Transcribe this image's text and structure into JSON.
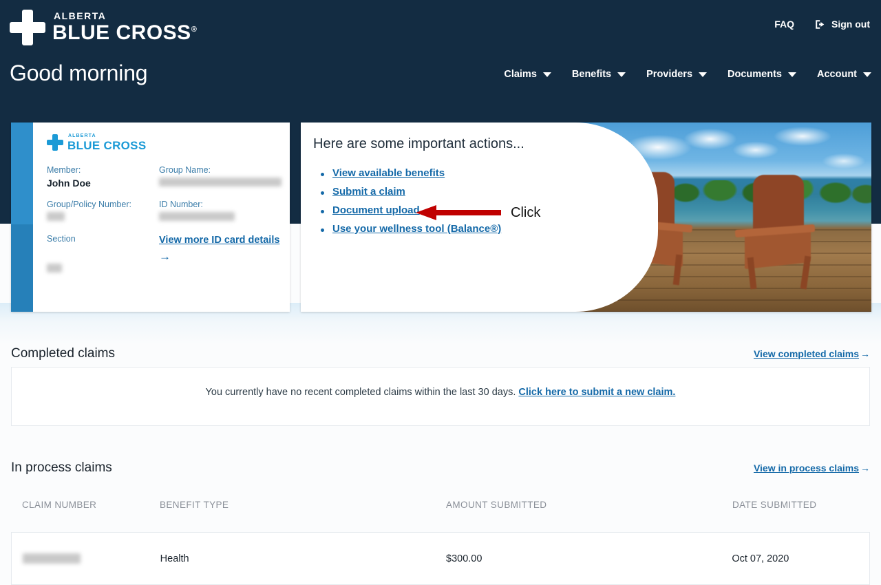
{
  "header": {
    "logo": {
      "alberta": "ALBERTA",
      "main": "BLUE CROSS",
      "reg": "®",
      "icon": "cross-icon"
    },
    "faq_label": "FAQ",
    "signout_label": "Sign out",
    "signout_icon": "sign-out-icon",
    "greeting": "Good morning",
    "nav": [
      {
        "label": "Claims",
        "icon": "chevron-down-icon"
      },
      {
        "label": "Benefits",
        "icon": "chevron-down-icon"
      },
      {
        "label": "Providers",
        "icon": "chevron-down-icon"
      },
      {
        "label": "Documents",
        "icon": "chevron-down-icon"
      },
      {
        "label": "Account",
        "icon": "chevron-down-icon"
      }
    ],
    "bg_color": "#132c42"
  },
  "id_card": {
    "logo": {
      "alberta": "ALBERTA",
      "main": "BLUE CROSS",
      "icon": "cross-icon"
    },
    "stripe_color": "#2f8fcb",
    "fields": {
      "member_label": "Member:",
      "member_value": "John Doe",
      "group_name_label": "Group Name:",
      "group_name_value": "",
      "group_policy_label": "Group/Policy Number:",
      "group_policy_value": "",
      "id_number_label": "ID Number:",
      "id_number_value": "",
      "section_label": "Section",
      "section_value": ""
    },
    "details_link": "View more ID card details",
    "details_arrow": "→"
  },
  "actions_card": {
    "title": "Here are some important actions...",
    "links": [
      "View available benefits",
      "Submit a claim",
      "Document upload",
      "Use your wellness tool (Balance®)"
    ],
    "photo_alt": "lake-dock-chairs-photo"
  },
  "annotation": {
    "label": "Click",
    "arrow_color": "#c00000",
    "arrow_icon": "left-arrow-annotation"
  },
  "completed_claims": {
    "title": "Completed claims",
    "view_link": "View completed claims",
    "view_link_arrow": "→",
    "empty_text": "You currently have no recent completed claims within the last 30 days.",
    "empty_link": "Click here to submit a new claim."
  },
  "in_process_claims": {
    "title": "In process claims",
    "view_link": "View in process claims",
    "view_link_arrow": "→",
    "columns": [
      "CLAIM NUMBER",
      "BENEFIT TYPE",
      "AMOUNT SUBMITTED",
      "DATE SUBMITTED"
    ],
    "rows": [
      {
        "claim_number": "",
        "benefit_type": "Health",
        "amount_submitted": "$300.00",
        "date_submitted": "Oct 07, 2020"
      }
    ]
  },
  "colors": {
    "header_navy": "#132c42",
    "link_blue": "#1469a8",
    "accent_blue": "#1b9ad6",
    "stripe_blue": "#2f8fcb",
    "annotation_red": "#c00000",
    "page_bg": "#fbfcfd"
  }
}
